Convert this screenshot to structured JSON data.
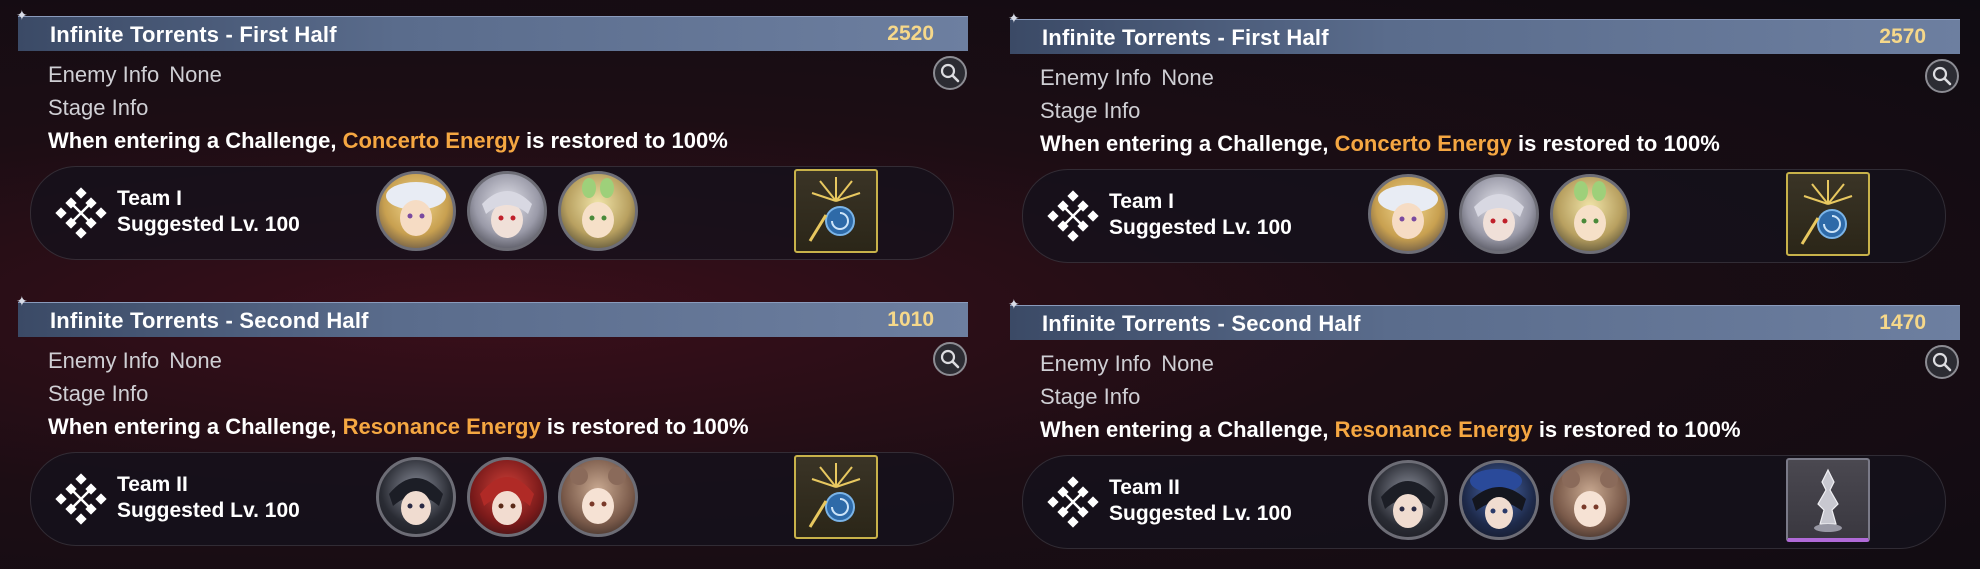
{
  "columns": [
    {
      "stages": [
        {
          "title": "Infinite Torrents - First Half",
          "score": "2520",
          "enemy_label": "Enemy Info",
          "enemy_value": "None",
          "stage_label": "Stage Info",
          "desc_prefix": "When entering a Challenge,",
          "desc_highlight": "Concerto Energy",
          "desc_suffix": "is restored to 100%",
          "team_name": "Team I",
          "suggested_level": "Suggested Lv. 100",
          "echo_icon": "golden-seahorse-echo",
          "echo_rarity": "gold",
          "avatars": [
            "blonde-white-hat",
            "silver-hair-red-eyes",
            "green-leaf-blonde"
          ]
        },
        {
          "title": "Infinite Torrents - Second Half",
          "score": "1010",
          "enemy_label": "Enemy Info",
          "enemy_value": "None",
          "stage_label": "Stage Info",
          "desc_prefix": "When entering a Challenge,",
          "desc_highlight": "Resonance Energy",
          "desc_suffix": "is restored to 100%",
          "team_name": "Team II",
          "suggested_level": "Suggested Lv. 100",
          "echo_icon": "golden-seahorse-echo",
          "echo_rarity": "gold",
          "avatars": [
            "dark-hair-black-coat",
            "red-hair",
            "bear-ear-girl"
          ]
        }
      ]
    },
    {
      "stages": [
        {
          "title": "Infinite Torrents - First Half",
          "score": "2570",
          "enemy_label": "Enemy Info",
          "enemy_value": "None",
          "stage_label": "Stage Info",
          "desc_prefix": "When entering a Challenge,",
          "desc_highlight": "Concerto Energy",
          "desc_suffix": "is restored to 100%",
          "team_name": "Team I",
          "suggested_level": "Suggested Lv. 100",
          "echo_icon": "golden-seahorse-echo",
          "echo_rarity": "gold",
          "avatars": [
            "blonde-white-hat",
            "silver-hair-red-eyes",
            "green-leaf-blonde"
          ]
        },
        {
          "title": "Infinite Torrents - Second Half",
          "score": "1470",
          "enemy_label": "Enemy Info",
          "enemy_value": "None",
          "stage_label": "Stage Info",
          "desc_prefix": "When entering a Challenge,",
          "desc_highlight": "Resonance Energy",
          "desc_suffix": "is restored to 100%",
          "team_name": "Team II",
          "suggested_level": "Suggested Lv. 100",
          "echo_icon": "silver-statue-echo",
          "echo_rarity": "purple",
          "avatars": [
            "dark-hair-black-coat",
            "blue-beret-dark-hair",
            "bear-ear-girl"
          ]
        }
      ]
    }
  ],
  "colors": {
    "highlight": "#f5a742",
    "score": "#f6d88a",
    "header_bar": "#5a6c8c"
  }
}
